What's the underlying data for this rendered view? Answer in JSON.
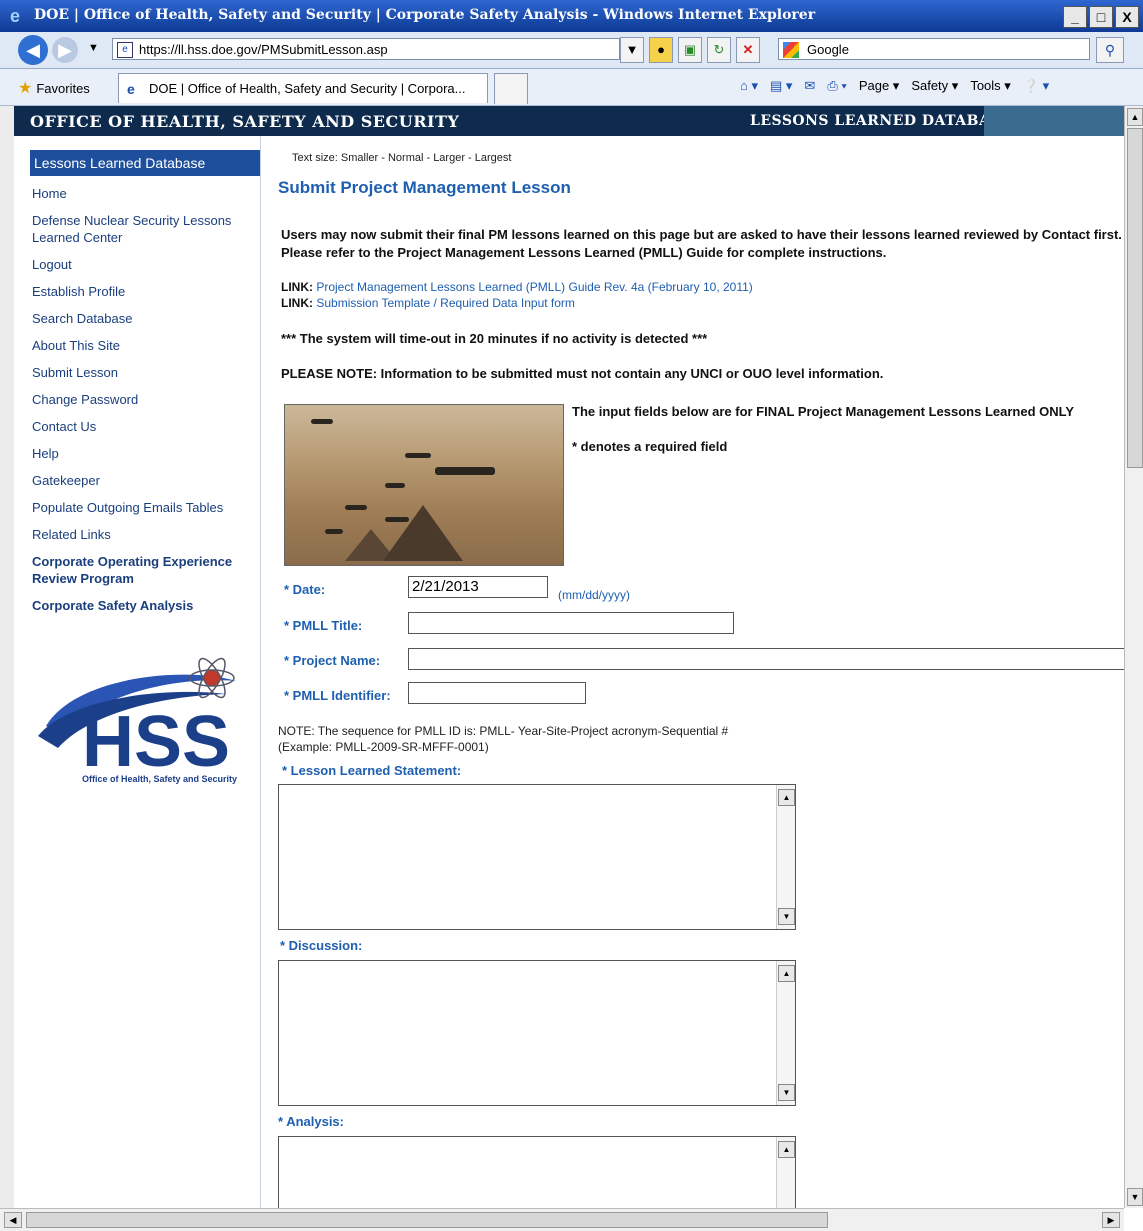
{
  "window": {
    "title": "DOE | Office of Health, Safety and Security | Corporate Safety Analysis - Windows Internet Explorer",
    "controls": [
      "_",
      "□",
      "X"
    ]
  },
  "address_bar": {
    "url": "https://ll.hss.doe.gov/PMSubmitLesson.asp",
    "search_engine": "Google"
  },
  "favorites_bar": {
    "favorites_label": "Favorites",
    "tab_title": "DOE | Office of Health, Safety and Security | Corpora...",
    "commands": [
      "Page ▾",
      "Safety ▾",
      "Tools ▾"
    ]
  },
  "banner": {
    "left": "OFFICE OF HEALTH, SAFETY AND SECURITY",
    "right": "LESSONS LEARNED DATABASE"
  },
  "sidebar": {
    "heading": "Lessons Learned Database",
    "items": [
      "Home",
      "Defense Nuclear Security Lessons Learned Center",
      "Logout",
      "Establish Profile",
      "Search Database",
      "About This Site",
      "Submit Lesson",
      "Change Password",
      "Contact Us",
      "Help",
      "Gatekeeper",
      "Populate Outgoing Emails Tables",
      "Related Links"
    ],
    "bold_items": [
      "Corporate Operating Experience Review Program",
      "Corporate Safety Analysis"
    ],
    "logo_text": "HSS",
    "logo_tagline": "Office of Health, Safety and Security"
  },
  "main": {
    "text_size": "Text size: Smaller - Normal - Larger - Largest",
    "title": "Submit Project Management Lesson",
    "intro": "Users may now submit their final PM lessons learned on this page but are asked to have their lessons learned reviewed by Contact first. Please refer to the Project Management Lessons Learned (PMLL) Guide for complete instructions.",
    "link_label": "LINK:",
    "link1": "Project Management Lessons Learned (PMLL) Guide Rev. 4a (February 10, 2011)",
    "link2": "Submission Template / Required Data Input form",
    "timeout": "*** The system will time-out in 20 minutes if no activity is detected ***",
    "please_note": "PLEASE NOTE: Information to be submitted must not contain any UNCI or OUO level information.",
    "final_note": "The input fields below are for FINAL Project Management Lessons Learned ONLY",
    "required_note": "* denotes a required field",
    "form": {
      "date_label": "* Date:",
      "date_value": "2/21/2013",
      "date_hint": "(mm/dd/yyyy)",
      "title_label": "* PMLL Title:",
      "project_label": "* Project Name:",
      "identifier_label": "* PMLL Identifier:",
      "seq_note_1": "NOTE: The sequence for PMLL ID is: PMLL- Year-Site-Project acronym-Sequential #",
      "seq_note_2": "(Example: PMLL-2009-SR-MFFF-0001)",
      "statement_label": "* Lesson Learned Statement:",
      "discussion_label": "* Discussion:",
      "analysis_label": "* Analysis:"
    }
  }
}
